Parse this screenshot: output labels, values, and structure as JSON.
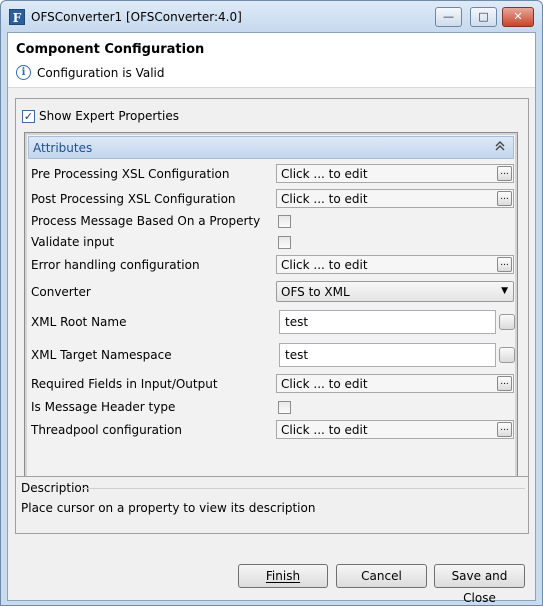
{
  "window": {
    "title": "OFSConverter1 [OFSConverter:4.0]",
    "app_icon_letter": "F",
    "minimize_glyph": "—",
    "maximize_glyph": "□",
    "close_glyph": "✕"
  },
  "header": {
    "title": "Component Configuration",
    "status": "Configuration is Valid",
    "info_glyph": "i"
  },
  "expert": {
    "label": "Show Expert Properties",
    "checked": true,
    "check_glyph": "✓"
  },
  "attributes": {
    "title": "Attributes",
    "collapse_glyph": "⌃",
    "rows": [
      {
        "label": "Pre Processing XSL Configuration",
        "type": "edit",
        "value": "Click ... to edit"
      },
      {
        "label": "Post Processing XSL Configuration",
        "type": "edit",
        "value": "Click ... to edit"
      },
      {
        "label": "Process Message Based On a Property",
        "type": "checkbox",
        "checked": false
      },
      {
        "label": "Validate input",
        "type": "checkbox",
        "checked": false
      },
      {
        "label": "Error handling configuration",
        "type": "edit",
        "value": "Click ... to edit"
      },
      {
        "label": "Converter",
        "type": "select",
        "value": "OFS to XML"
      },
      {
        "label": "XML Root Name",
        "type": "text",
        "value": "test"
      },
      {
        "label": "XML Target Namespace",
        "type": "text",
        "value": "test"
      },
      {
        "label": "Required Fields in Input/Output",
        "type": "edit",
        "value": "Click ... to edit"
      },
      {
        "label": "Is Message Header type",
        "type": "checkbox",
        "checked": false
      },
      {
        "label": "Threadpool configuration",
        "type": "edit",
        "value": "Click ... to edit"
      }
    ],
    "ellipsis_glyph": "...",
    "dropdown_glyph": "▼"
  },
  "description": {
    "title": "Description",
    "text": "Place cursor on a property to view its description"
  },
  "buttons": {
    "finish": "Finish",
    "cancel": "Cancel",
    "save_close": "Save and Close"
  },
  "colors": {
    "accent_header": "#1f4f8f",
    "close_button": "#c7452a"
  }
}
